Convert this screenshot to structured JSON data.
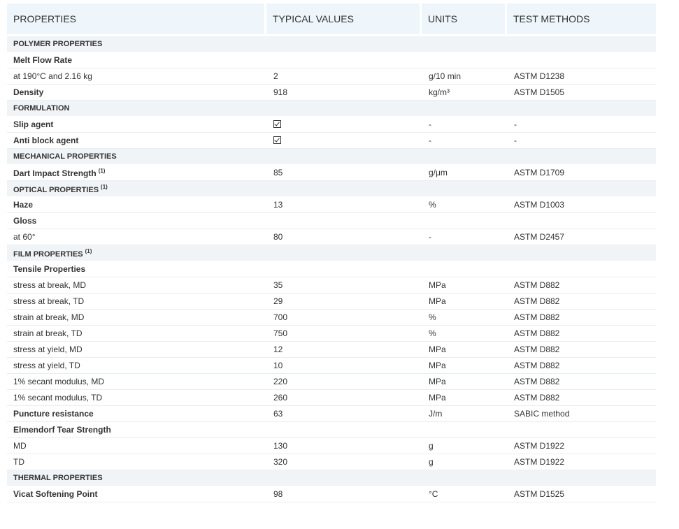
{
  "headers": [
    "PROPERTIES",
    "TYPICAL VALUES",
    "UNITS",
    "TEST METHODS"
  ],
  "rows": [
    {
      "type": "section",
      "label": "POLYMER PROPERTIES",
      "sup": ""
    },
    {
      "type": "subhead",
      "label": "Melt Flow Rate",
      "sup": ""
    },
    {
      "type": "data",
      "bold": false,
      "label": "at 190°C and 2.16 kg",
      "sup": "",
      "value": "2",
      "unit": "g/10 min",
      "method": "ASTM D1238"
    },
    {
      "type": "data",
      "bold": true,
      "label": "Density",
      "sup": "",
      "value": "918",
      "unit": "kg/m³",
      "method": "ASTM D1505"
    },
    {
      "type": "section",
      "label": "FORMULATION",
      "sup": ""
    },
    {
      "type": "data",
      "bold": true,
      "label": "Slip agent",
      "sup": "",
      "value": "",
      "check": true,
      "unit": "-",
      "method": "-"
    },
    {
      "type": "data",
      "bold": true,
      "label": "Anti block agent",
      "sup": "",
      "value": "",
      "check": true,
      "unit": "-",
      "method": "-"
    },
    {
      "type": "section",
      "label": "MECHANICAL PROPERTIES",
      "sup": ""
    },
    {
      "type": "data",
      "bold": true,
      "label": "Dart Impact Strength",
      "sup": "(1)",
      "value": "85",
      "unit": "g/μm",
      "method": "ASTM D1709"
    },
    {
      "type": "section",
      "label": "OPTICAL PROPERTIES",
      "sup": "(1)"
    },
    {
      "type": "data",
      "bold": true,
      "label": "Haze",
      "sup": "",
      "value": "13",
      "unit": "%",
      "method": "ASTM D1003"
    },
    {
      "type": "subhead",
      "label": "Gloss",
      "sup": ""
    },
    {
      "type": "data",
      "bold": false,
      "label": "at 60°",
      "sup": "",
      "value": "80",
      "unit": "-",
      "method": "ASTM D2457"
    },
    {
      "type": "section",
      "label": "FILM PROPERTIES",
      "sup": "(1)"
    },
    {
      "type": "subhead",
      "label": "Tensile Properties",
      "sup": ""
    },
    {
      "type": "data",
      "bold": false,
      "label": "stress at break, MD",
      "sup": "",
      "value": "35",
      "unit": "MPa",
      "method": "ASTM D882"
    },
    {
      "type": "data",
      "bold": false,
      "label": "stress at break, TD",
      "sup": "",
      "value": "29",
      "unit": "MPa",
      "method": "ASTM D882"
    },
    {
      "type": "data",
      "bold": false,
      "label": "strain at break, MD",
      "sup": "",
      "value": "700",
      "unit": "%",
      "method": "ASTM D882"
    },
    {
      "type": "data",
      "bold": false,
      "label": "strain at break, TD",
      "sup": "",
      "value": "750",
      "unit": "%",
      "method": "ASTM D882"
    },
    {
      "type": "data",
      "bold": false,
      "label": "stress at yield, MD",
      "sup": "",
      "value": "12",
      "unit": "MPa",
      "method": "ASTM D882"
    },
    {
      "type": "data",
      "bold": false,
      "label": "stress at yield, TD",
      "sup": "",
      "value": "10",
      "unit": "MPa",
      "method": "ASTM D882"
    },
    {
      "type": "data",
      "bold": false,
      "label": "1% secant modulus, MD",
      "sup": "",
      "value": "220",
      "unit": "MPa",
      "method": "ASTM D882"
    },
    {
      "type": "data",
      "bold": false,
      "label": "1% secant modulus, TD",
      "sup": "",
      "value": "260",
      "unit": "MPa",
      "method": "ASTM D882"
    },
    {
      "type": "data",
      "bold": true,
      "label": "Puncture resistance",
      "sup": "",
      "value": "63",
      "unit": "J/m",
      "method": "SABIC method"
    },
    {
      "type": "subhead",
      "label": "Elmendorf Tear Strength",
      "sup": ""
    },
    {
      "type": "data",
      "bold": false,
      "label": "MD",
      "sup": "",
      "value": "130",
      "unit": "g",
      "method": "ASTM D1922"
    },
    {
      "type": "data",
      "bold": false,
      "label": "TD",
      "sup": "",
      "value": "320",
      "unit": "g",
      "method": "ASTM D1922"
    },
    {
      "type": "section",
      "label": "THERMAL PROPERTIES",
      "sup": ""
    },
    {
      "type": "data",
      "bold": true,
      "label": "Vicat Softening Point",
      "sup": "",
      "value": "98",
      "unit": "°C",
      "method": "ASTM D1525"
    }
  ]
}
